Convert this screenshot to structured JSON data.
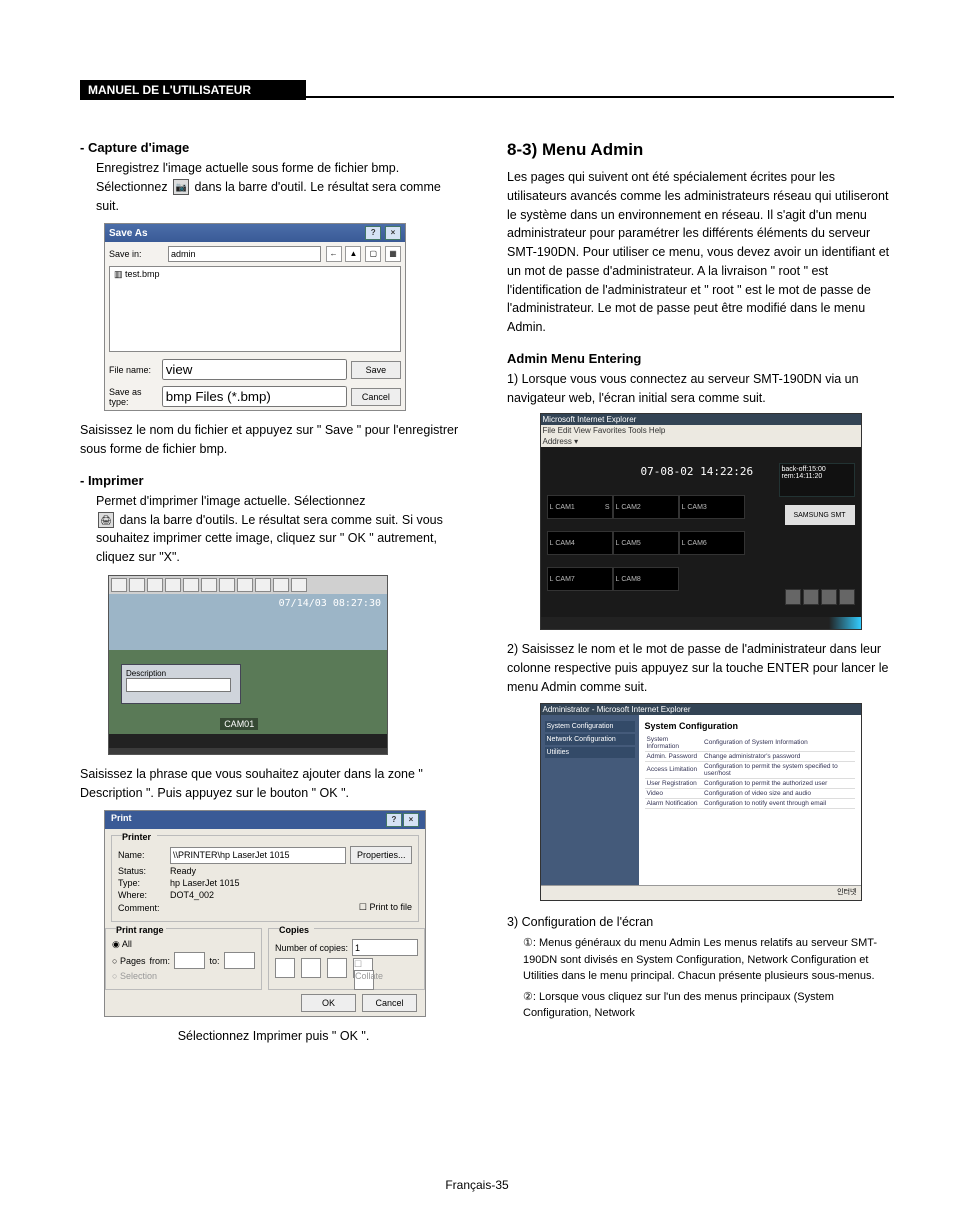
{
  "header": {
    "label": "MANUEL DE L'UTILISATEUR"
  },
  "left": {
    "capture_heading": "-  Capture d'image",
    "capture_p1a": "Enregistrez l'image actuelle sous forme de fichier bmp. Sélectionnez",
    "capture_icon": "📷",
    "capture_p1b": "dans la barre d'outil. Le résultat sera comme suit.",
    "saveas": {
      "title": "Save As",
      "savein_label": "Save in:",
      "savein_value": "admin",
      "file_listed": "test.bmp",
      "name_label": "File name:",
      "name_value": "view",
      "type_label": "Save as type:",
      "type_value": "bmp Files (*.bmp)",
      "save_btn": "Save",
      "cancel_btn": "Cancel"
    },
    "save_p": "Saisissez le nom du fichier et appuyez sur \" Save \" pour l'enregistrer sous forme de fichier bmp.",
    "print_heading": "-  Imprimer",
    "print_p1": "Permet d'imprimer l'image actuelle. Sélectionnez",
    "print_icon": "🖨",
    "print_p2": "dans la barre d'outils. Le résultat sera comme suit. Si vous souhaitez imprimer cette image, cliquez sur \" OK \" autrement, cliquez sur \"X\".",
    "viewer": {
      "timestamp": "07/14/03   08:27:30",
      "cam": "CAM01",
      "desc_title": "Description",
      "desc_input": ""
    },
    "desc_p": "Saisissez la phrase que vous souhaitez ajouter dans la zone \" Description \". Puis appuyez sur le bouton \" OK \".",
    "printdlg": {
      "title": "Print",
      "printer_section": "Printer",
      "name_label": "Name:",
      "name_value": "\\\\PRINTER\\hp LaserJet 1015",
      "properties": "Properties...",
      "status_label": "Status:",
      "status_value": "Ready",
      "type_label": "Type:",
      "type_value": "hp LaserJet 1015",
      "where_label": "Where:",
      "where_value": "DOT4_002",
      "comment_label": "Comment:",
      "printtofile": "Print to file",
      "range_section": "Print range",
      "all": "All",
      "pages": "Pages",
      "from": "from:",
      "to": "to:",
      "selection": "Selection",
      "copies_section": "Copies",
      "numcopies": "Number of copies:",
      "numcopies_val": "1",
      "collate": "Collate",
      "ok": "OK",
      "cancel": "Cancel"
    },
    "print_final": "Sélectionnez Imprimer puis \" OK \"."
  },
  "right": {
    "menuadmin_heading": "8-3) Menu Admin",
    "menuadmin_p": "Les pages qui suivent ont été spécialement écrites pour les utilisateurs avancés comme les administrateurs réseau qui utiliseront le système dans un environnement en réseau. Il s'agit d'un menu administrateur pour paramétrer les différents éléments du serveur SMT-190DN. Pour utiliser ce menu, vous devez avoir un identifiant et un mot de passe d'administrateur. A la livraison \" root \" est l'identification de l'administrateur et \" root \" est le mot de passe de l'administrateur. Le mot de passe peut être modifié dans le menu Admin.",
    "admin_entering_heading": "Admin Menu Entering",
    "step1": "1) Lorsque vous vous connectez au serveur SMT-190DN via un navigateur web, l'écran initial sera comme suit.",
    "browser1": {
      "date_time": "07-08-02   14:22:26",
      "side_line1": "back-off:15:00",
      "side_line2": "rem:14:11:20",
      "brand": "SAMSUNG SMT",
      "cams": [
        "CAM1",
        "CAM2",
        "CAM3",
        "CAM4",
        "CAM5",
        "CAM6",
        "CAM7",
        "CAM8"
      ]
    },
    "step2": "2)  Saisissez le nom et le mot de passe de l'administrateur dans leur colonne respective puis appuyez sur la touche ENTER pour lancer le menu Admin comme suit.",
    "browser2": {
      "window_title": "Administrator - Microsoft Internet Explorer",
      "side_items": [
        "System Configuration",
        "Network Configuration",
        "Utilities"
      ],
      "main_title": "System Configuration",
      "rows": [
        [
          "System Information",
          "Configuration of System Information"
        ],
        [
          "Admin. Password",
          "Change administrator's password"
        ],
        [
          "Access Limitation",
          "Configuration to permit the system specified to user/host"
        ],
        [
          "User Registration",
          "Configuration to permit the authorized user"
        ],
        [
          "Video",
          "Configuration of video size and audio"
        ],
        [
          "Alarm Notification",
          "Configuration to notify event through email"
        ]
      ],
      "status_right": "인터넷"
    },
    "step3_head": "3)  Configuration de l'écran",
    "step3_1": "①: Menus généraux du menu Admin Les menus relatifs au serveur SMT-190DN sont divisés en System Configuration, Network Configuration et  Utilities dans le menu principal. Chacun présente  plusieurs sous-menus.",
    "step3_2": "②: Lorsque vous cliquez sur l'un des menus principaux (System Configuration, Network"
  },
  "footer": "Français-35"
}
